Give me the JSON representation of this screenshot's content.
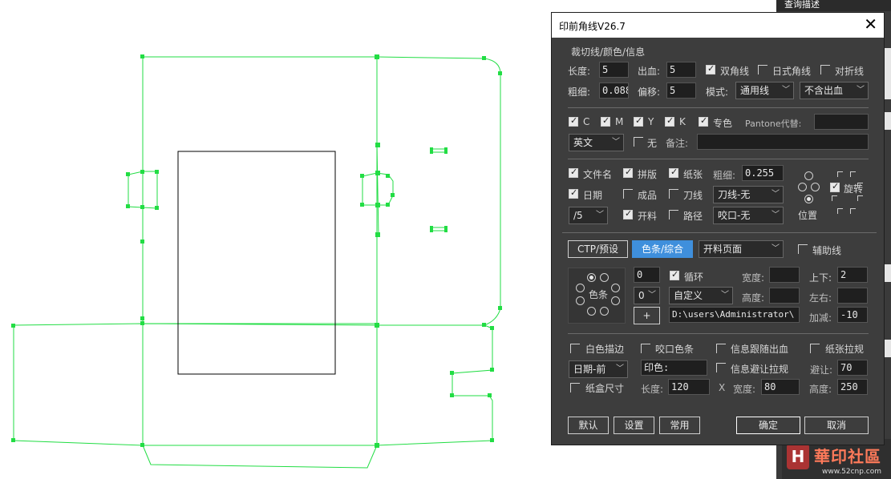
{
  "dialog": {
    "title": "印前角线V26.7",
    "close_symbol": "✕",
    "trim_group": {
      "title": "裁切线/颜色/信息",
      "length_label": "长度:",
      "length_value": "5",
      "bleed_label": "出血:",
      "bleed_value": "5",
      "double_corner_label": "双角线",
      "double_corner_checked": true,
      "jp_corner_label": "日式角线",
      "jp_corner_checked": false,
      "fold_label": "对折线",
      "fold_checked": false,
      "thickness_label": "粗细:",
      "thickness_value": "0.088",
      "offset_label": "偏移:",
      "offset_value": "5",
      "mode_label": "模式:",
      "mode_value": "通用线",
      "bleed_mode_value": "不含出血"
    },
    "colors": {
      "c_label": "C",
      "c_checked": true,
      "m_label": "M",
      "m_checked": true,
      "y_label": "Y",
      "y_checked": true,
      "k_label": "K",
      "k_checked": true,
      "spot_label": "专色",
      "spot_checked": true,
      "pantone_label": "Pantone代替:",
      "pantone_value": "",
      "language_value": "英文",
      "none_label": "无",
      "none_checked": false,
      "note_label": "备注:",
      "note_value": ""
    },
    "info": {
      "filename_label": "文件名",
      "filename_checked": true,
      "imposition_label": "拼版",
      "imposition_checked": true,
      "paper_label": "纸张",
      "paper_checked": true,
      "thickness_label": "粗细:",
      "thickness_value": "0.255",
      "date_label": "日期",
      "date_checked": true,
      "product_label": "成品",
      "product_checked": false,
      "knife_label": "刀线",
      "knife_checked": false,
      "knife_value": "刀线-无",
      "date_format_value": "/5",
      "cut_label": "开料",
      "cut_checked": true,
      "path_label": "路径",
      "path_checked": false,
      "bite_value": "咬口-无",
      "position_label": "位置",
      "rotate_label": "旋转",
      "rotate_checked": true
    },
    "tabs": {
      "ctp_label": "CTP/预设",
      "colorbar_label": "色条/综合",
      "cut_page_value": "开料页面",
      "aux_label": "辅助线",
      "aux_checked": false
    },
    "colorbar": {
      "colorbar_label": "色条",
      "count_value": "0",
      "count2_value": "0",
      "loop_label": "循环",
      "loop_checked": true,
      "custom_value": "自定义",
      "add_label": "+",
      "path_value": "D:\\users\\Administrator\\",
      "width_label": "宽度:",
      "width_value": "",
      "height_label": "高度:",
      "height_value": "",
      "updown_label": "上下:",
      "updown_value": "2",
      "leftright_label": "左右:",
      "leftright_value": "",
      "addsub_label": "加减:",
      "addsub_value": "-10"
    },
    "misc": {
      "white_edge_label": "白色描边",
      "white_edge_checked": false,
      "bite_color_label": "咬口色条",
      "bite_color_checked": false,
      "info_bleed_label": "信息跟随出血",
      "info_bleed_checked": false,
      "paper_rule_label": "纸张拉规",
      "paper_rule_checked": false,
      "date_pos_value": "日期-前",
      "print_color_value": "印色:",
      "info_avoid_label": "信息避让拉规",
      "info_avoid_checked": false,
      "avoid_label": "避让:",
      "avoid_value": "70",
      "box_size_label": "纸盒尺寸",
      "box_size_checked": false,
      "length_label": "长度:",
      "length_value": "120",
      "x_label": "X",
      "width_label": "宽度:",
      "width_value": "80",
      "height_label": "高度:",
      "height_value": "250"
    },
    "buttons": {
      "default_label": "默认",
      "settings_label": "设置",
      "common_label": "常用",
      "ok_label": "确定",
      "cancel_label": "取消"
    }
  },
  "background": {
    "right_panel_title": "查询描述",
    "watermark_text": "華印社區",
    "watermark_url": "www.52cnp.com"
  },
  "colors": {
    "dieline": "#22dd44",
    "dialog_bg": "#3d3d3d",
    "accent": "#3f8fdc"
  }
}
